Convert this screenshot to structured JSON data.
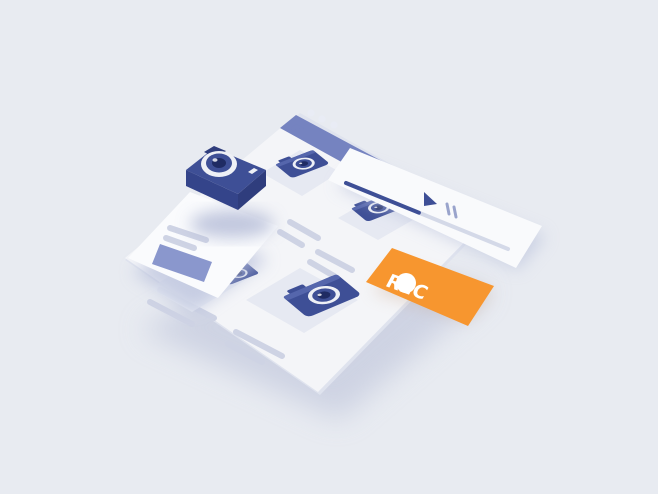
{
  "illustration": {
    "record_badge": {
      "label": "REC"
    },
    "player": {
      "progress": 0.5
    },
    "icons": [
      "camera-icon",
      "play-icon",
      "pause-icon",
      "record-dot-icon"
    ]
  },
  "colors": {
    "background": "#e8ebf1",
    "window_chrome": "#7583c0",
    "window_body": "#f4f5f8",
    "camera_dark": "#3e4f96",
    "camera_light": "#eef0f6",
    "record_orange": "#f7962f",
    "placeholder_line": "#ced3e4",
    "placeholder_block": "#8a97cd"
  }
}
